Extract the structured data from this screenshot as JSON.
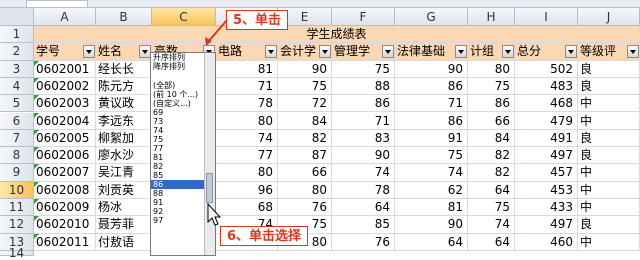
{
  "toolbar": {
    "cell_ref": "010",
    "formula_value": "70"
  },
  "columns": [
    "A",
    "B",
    "C",
    "D",
    "E",
    "F",
    "G",
    "H",
    "I",
    "J"
  ],
  "selected_column": "C",
  "title_row": {
    "row": "1",
    "text": "学生成绩表"
  },
  "header_row": {
    "row": "2",
    "cells": [
      "学号",
      "姓名",
      "高数",
      "电路",
      "会计学",
      "管理学",
      "法律基础",
      "计组",
      "总分",
      "等级评"
    ]
  },
  "rows": [
    {
      "row": "3",
      "cells": [
        "0602001",
        "经长长",
        "",
        "81",
        "90",
        "75",
        "90",
        "80",
        "502",
        "良"
      ]
    },
    {
      "row": "4",
      "cells": [
        "0602002",
        "陈元方",
        "",
        "71",
        "75",
        "88",
        "86",
        "75",
        "483",
        "良"
      ]
    },
    {
      "row": "5",
      "cells": [
        "0602003",
        "黄议政",
        "",
        "78",
        "72",
        "86",
        "71",
        "86",
        "468",
        "中"
      ]
    },
    {
      "row": "6",
      "cells": [
        "0602004",
        "李远东",
        "",
        "80",
        "84",
        "71",
        "86",
        "66",
        "479",
        "中"
      ]
    },
    {
      "row": "7",
      "cells": [
        "0602005",
        "柳絮加",
        "",
        "74",
        "82",
        "83",
        "91",
        "84",
        "491",
        "良"
      ]
    },
    {
      "row": "8",
      "cells": [
        "0602006",
        "廖水沙",
        "",
        "77",
        "87",
        "90",
        "75",
        "82",
        "497",
        "良"
      ]
    },
    {
      "row": "9",
      "cells": [
        "0602007",
        "吴江青",
        "",
        "80",
        "66",
        "74",
        "74",
        "82",
        "457",
        "中"
      ]
    },
    {
      "row": "10",
      "cells": [
        "0602008",
        "刘贡英",
        "",
        "96",
        "80",
        "78",
        "62",
        "64",
        "453",
        "中"
      ]
    },
    {
      "row": "11",
      "cells": [
        "0602009",
        "杨冰",
        "",
        "68",
        "76",
        "64",
        "81",
        "75",
        "433",
        "中"
      ]
    },
    {
      "row": "12",
      "cells": [
        "0602010",
        "聂芳菲",
        "",
        "74",
        "75",
        "85",
        "90",
        "74",
        "497",
        "良"
      ]
    },
    {
      "row": "13",
      "cells": [
        "0602011",
        "付敖语",
        "",
        "55",
        "80",
        "76",
        "64",
        "64",
        "460",
        "中"
      ]
    }
  ],
  "selected_row": "10",
  "partial_row": "14",
  "filter_dropdown": {
    "options": [
      "升序排列",
      "降序排列",
      "(全部)",
      "(前 10 个...)",
      "(自定义...)",
      "69",
      "73",
      "74",
      "75",
      "77",
      "81",
      "82",
      "85",
      "86",
      "88",
      "91",
      "92",
      "97"
    ],
    "highlighted": "86"
  },
  "annotations": {
    "step5": "5、单击",
    "step6": "6、单击选择"
  },
  "colors": {
    "header_fill": "#fbd7b4",
    "highlight": "#316ac5",
    "callout": "#d63a1e"
  }
}
